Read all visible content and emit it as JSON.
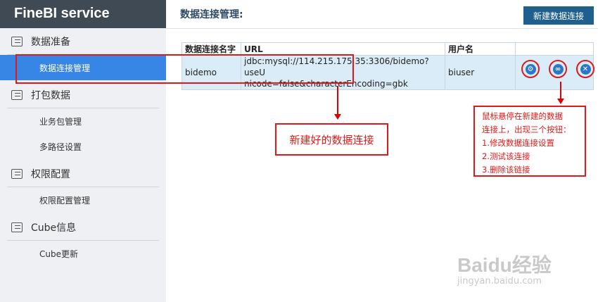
{
  "sidebar": {
    "brand": "FineBI service",
    "groups": [
      {
        "label": "数据准备",
        "icon": "list-icon",
        "items": [
          "数据连接管理"
        ]
      },
      {
        "label": "打包数据",
        "icon": "list-icon",
        "items": [
          "业务包管理",
          "多路径设置"
        ]
      },
      {
        "label": "权限配置",
        "icon": "list-icon",
        "items": [
          "权限配置管理"
        ]
      },
      {
        "label": "Cube信息",
        "icon": "list-icon",
        "items": [
          "Cube更新"
        ]
      }
    ],
    "active_item": "数据连接管理"
  },
  "main": {
    "title": "数据连接管理:",
    "new_button": "新建数据连接",
    "table": {
      "headers": [
        "数据连接名字",
        "URL",
        "用户名"
      ],
      "rows": [
        {
          "name": "bidemo",
          "url": "jdbc:mysql://114.215.175.35:3306/bidemo?useUnicode=false&characterEncoding=gbk",
          "url_line1": "jdbc:mysql://114.215.175.35:3306/bidemo?useU",
          "url_line2": "nicode=false&characterEncoding=gbk",
          "user": "biuser"
        }
      ]
    },
    "row_actions": [
      "settings-icon",
      "link-icon",
      "delete-icon"
    ]
  },
  "annotations": {
    "note1": "新建好的数据连接",
    "note2_lines": [
      "鼠标悬停在新建的数据",
      "连接上，出现三个按钮：",
      "1.修改数据连接设置",
      "2.测试该连接",
      "3.删除该链接"
    ]
  },
  "watermark": {
    "text": "Baidu经验",
    "sub": "jingyan.baidu.com"
  },
  "colors": {
    "accent": "#3786e5",
    "brand_bg": "#404a55",
    "button": "#1f5f8e",
    "annotation": "#e01818"
  }
}
